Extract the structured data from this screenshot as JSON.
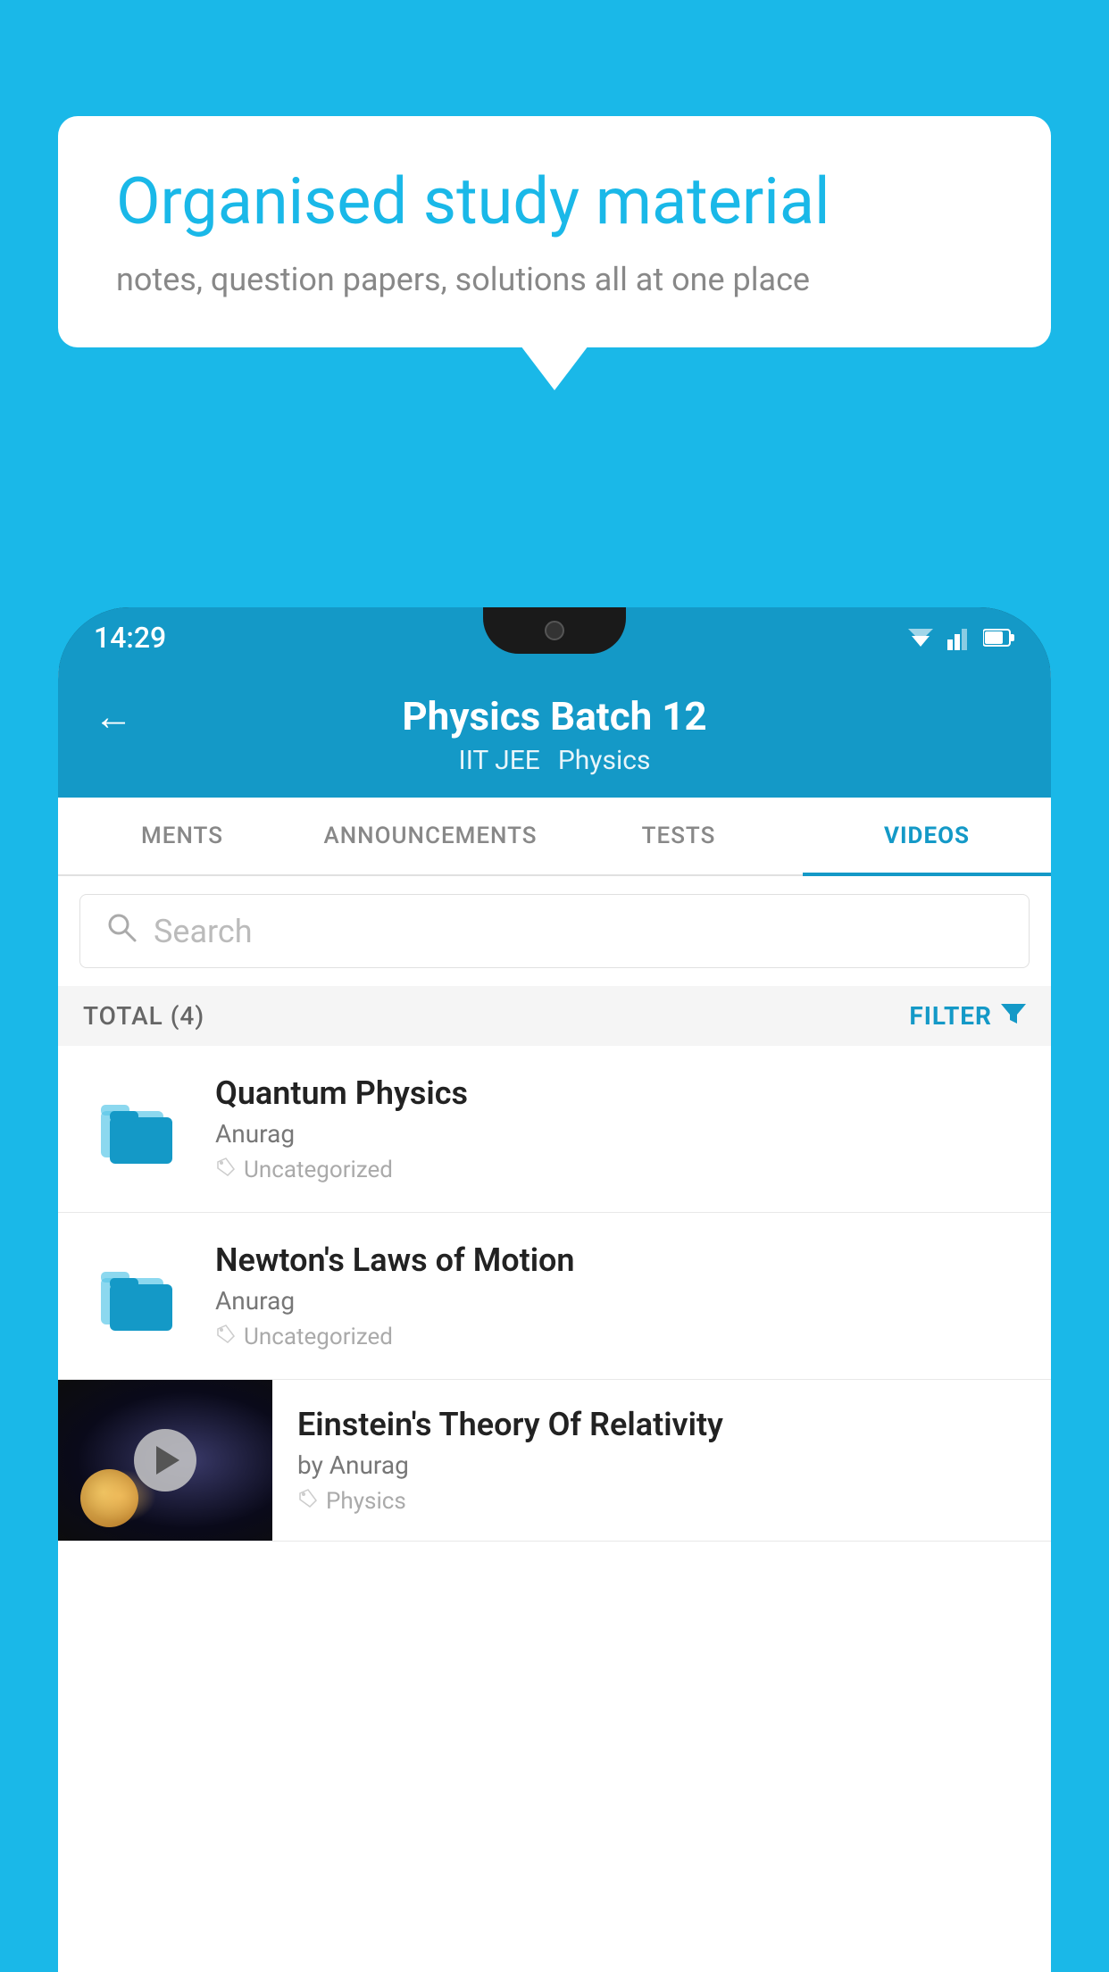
{
  "background_color": "#1ab8e8",
  "speech_bubble": {
    "title": "Organised study material",
    "subtitle": "notes, question papers, solutions all at one place"
  },
  "phone": {
    "status_bar": {
      "time": "14:29"
    },
    "header": {
      "back_label": "←",
      "title": "Physics Batch 12",
      "subtitle_1": "IIT JEE",
      "subtitle_2": "Physics"
    },
    "tabs": [
      {
        "label": "MENTS",
        "active": false
      },
      {
        "label": "ANNOUNCEMENTS",
        "active": false
      },
      {
        "label": "TESTS",
        "active": false
      },
      {
        "label": "VIDEOS",
        "active": true
      }
    ],
    "search": {
      "placeholder": "Search"
    },
    "filter_row": {
      "total_label": "TOTAL (4)",
      "filter_label": "FILTER"
    },
    "videos": [
      {
        "id": 1,
        "title": "Quantum Physics",
        "author": "Anurag",
        "tag": "Uncategorized",
        "has_thumbnail": false
      },
      {
        "id": 2,
        "title": "Newton's Laws of Motion",
        "author": "Anurag",
        "tag": "Uncategorized",
        "has_thumbnail": false
      },
      {
        "id": 3,
        "title": "Einstein's Theory Of Relativity",
        "author": "by Anurag",
        "tag": "Physics",
        "has_thumbnail": true
      }
    ]
  }
}
